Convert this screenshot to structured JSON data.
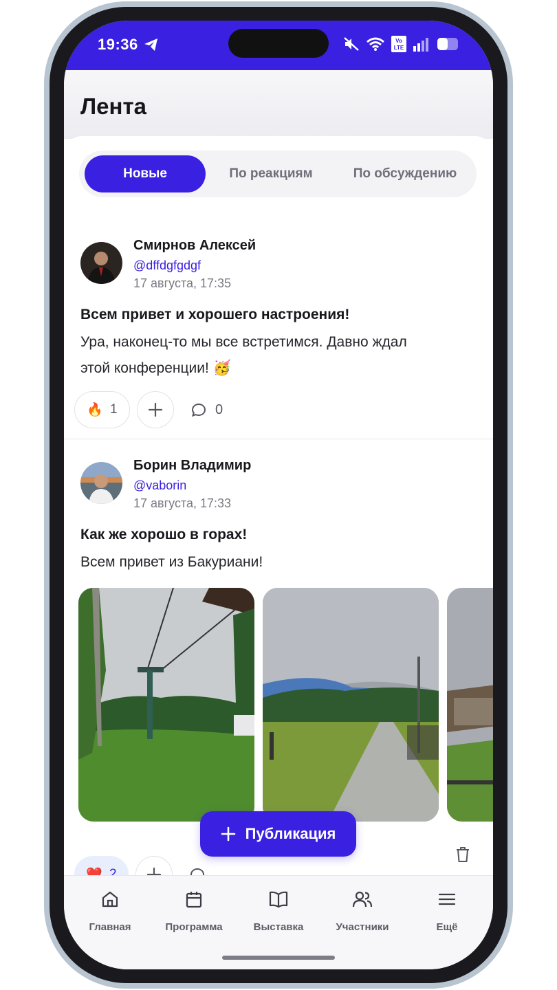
{
  "status_bar": {
    "time": "19:36",
    "volte": "Vo LTE"
  },
  "header": {
    "title": "Лента"
  },
  "tabs": [
    {
      "label": "Новые",
      "active": true
    },
    {
      "label": "По реакциям",
      "active": false
    },
    {
      "label": "По обсуждению",
      "active": false
    }
  ],
  "posts": [
    {
      "author": "Смирнов Алексей",
      "handle": "@dffdgfgdgf",
      "date": "17 августа, 17:35",
      "title": "Всем привет и хорошего настроения!",
      "body_line1": "Ура, наконец-то мы все встретимся. Давно ждал",
      "body_line2": "этой конференции! 🥳",
      "reaction_emoji": "🔥",
      "reaction_count": "1",
      "comments_count": "0"
    },
    {
      "author": "Борин Владимир",
      "handle": "@vaborin",
      "date": "17 августа, 17:33",
      "title": "Как же хорошо в горах!",
      "body": "Всем привет из Бакуриани!",
      "reaction_emoji": "❤️",
      "reaction_count": "2"
    }
  ],
  "fab": {
    "label": "Публикация"
  },
  "nav": [
    {
      "label": "Главная",
      "icon": "home-icon"
    },
    {
      "label": "Программа",
      "icon": "calendar-icon"
    },
    {
      "label": "Выставка",
      "icon": "book-icon"
    },
    {
      "label": "Участники",
      "icon": "users-icon"
    },
    {
      "label": "Ещё",
      "icon": "menu-icon"
    }
  ],
  "colors": {
    "accent": "#3a20e0",
    "handle": "#3a20e0",
    "text": "#18181c",
    "muted": "#7a7a84"
  }
}
